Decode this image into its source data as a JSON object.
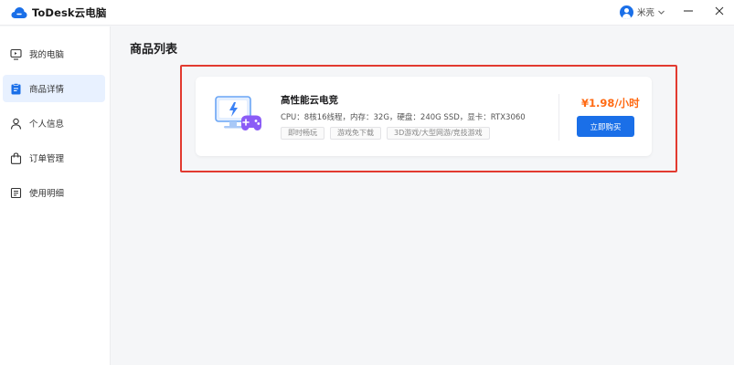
{
  "app": {
    "title": "ToDesk云电脑"
  },
  "user": {
    "name": "米亮"
  },
  "sidebar": {
    "items": [
      {
        "label": "我的电脑",
        "icon": "monitor-icon",
        "active": false
      },
      {
        "label": "商品详情",
        "icon": "clipboard-icon",
        "active": true
      },
      {
        "label": "个人信息",
        "icon": "person-icon",
        "active": false
      },
      {
        "label": "订单管理",
        "icon": "bag-icon",
        "active": false
      },
      {
        "label": "使用明细",
        "icon": "list-doc-icon",
        "active": false
      }
    ]
  },
  "main": {
    "title": "商品列表",
    "product": {
      "name": "高性能云电竞",
      "spec": "CPU：8核16线程，内存：32G，硬盘：240G SSD，显卡：RTX3060",
      "tags": [
        "即时畅玩",
        "游戏免下载",
        "3D游戏/大型网游/竞技游戏"
      ],
      "price": "¥1.98/小时",
      "buy_label": "立即购买",
      "icon": "cloud-gaming-monitor-icon"
    }
  },
  "colors": {
    "accent": "#1a6fe8",
    "price": "#ff6a13",
    "highlight": "#e23a30",
    "active_nav_bg": "#e8f1ff"
  }
}
